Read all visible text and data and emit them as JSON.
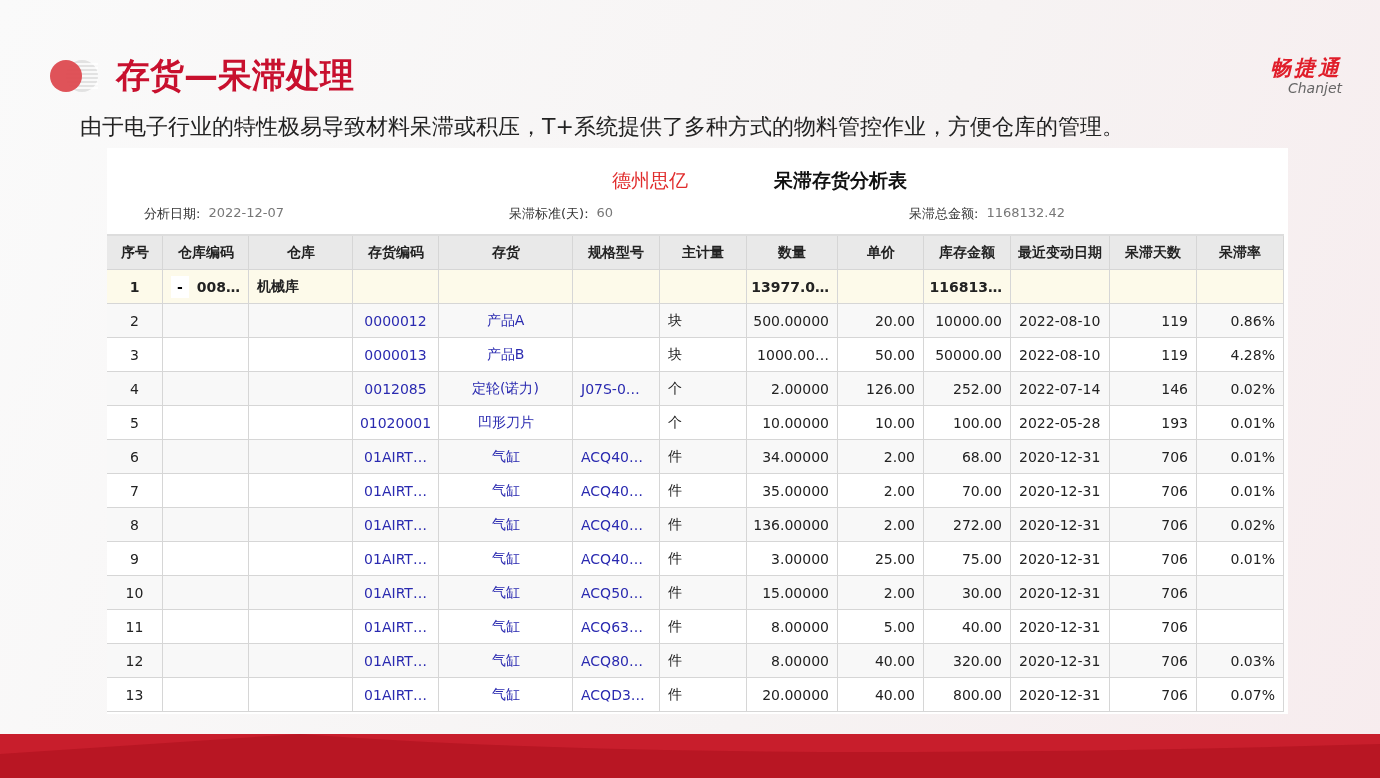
{
  "slide": {
    "title": "存货—呆滞处理",
    "subtitle": "由于电子行业的特性极易导致材料呆滞或积压，T+系统提供了多种方式的物料管控作业，方便仓库的管理。",
    "brand": {
      "name": "畅捷通",
      "latin": "Chanjet"
    }
  },
  "report": {
    "company": "德州思亿",
    "title": "呆滞存货分析表",
    "meta": [
      {
        "label": "分析日期:",
        "value": "2022-12-07"
      },
      {
        "label": "呆滞标准(天):",
        "value": "60"
      },
      {
        "label": "呆滞总金额:",
        "value": "1168132.42"
      }
    ],
    "columns": [
      "序号",
      "仓库编码",
      "仓库",
      "存货编码",
      "存货",
      "规格型号",
      "主计量",
      "数量",
      "单价",
      "库存金额",
      "最近变动日期",
      "呆滞天数",
      "呆滞率"
    ],
    "rows": [
      {
        "kind": "group",
        "toggle": "-",
        "cells": [
          "1",
          "008…",
          "机械库",
          null,
          null,
          null,
          null,
          "13977.0…",
          null,
          "116813…",
          null,
          null,
          null
        ]
      },
      {
        "kind": "item",
        "cells": [
          "2",
          null,
          null,
          "0000012",
          "产品A",
          null,
          "块",
          "500.00000",
          "20.00",
          "10000.00",
          "2022-08-10",
          "119",
          "0.86%"
        ]
      },
      {
        "kind": "item",
        "cells": [
          "3",
          null,
          null,
          "0000013",
          "产品B",
          null,
          "块",
          "1000.00…",
          "50.00",
          "50000.00",
          "2022-08-10",
          "119",
          "4.28%"
        ]
      },
      {
        "kind": "item",
        "cells": [
          "4",
          null,
          null,
          "0012085",
          "定轮(诺力)",
          "J07S-0…",
          "个",
          "2.00000",
          "126.00",
          "252.00",
          "2022-07-14",
          "146",
          "0.02%"
        ]
      },
      {
        "kind": "item",
        "cells": [
          "5",
          null,
          null,
          "01020001",
          "凹形刀片",
          null,
          "个",
          "10.00000",
          "10.00",
          "100.00",
          "2022-05-28",
          "193",
          "0.01%"
        ]
      },
      {
        "kind": "item",
        "cells": [
          "6",
          null,
          null,
          "01AIRT…",
          "气缸",
          "ACQ40…",
          "件",
          "34.00000",
          "2.00",
          "68.00",
          "2020-12-31",
          "706",
          "0.01%"
        ]
      },
      {
        "kind": "item",
        "cells": [
          "7",
          null,
          null,
          "01AIRT…",
          "气缸",
          "ACQ40…",
          "件",
          "35.00000",
          "2.00",
          "70.00",
          "2020-12-31",
          "706",
          "0.01%"
        ]
      },
      {
        "kind": "item",
        "cells": [
          "8",
          null,
          null,
          "01AIRT…",
          "气缸",
          "ACQ40…",
          "件",
          "136.00000",
          "2.00",
          "272.00",
          "2020-12-31",
          "706",
          "0.02%"
        ]
      },
      {
        "kind": "item",
        "cells": [
          "9",
          null,
          null,
          "01AIRT…",
          "气缸",
          "ACQ40…",
          "件",
          "3.00000",
          "25.00",
          "75.00",
          "2020-12-31",
          "706",
          "0.01%"
        ]
      },
      {
        "kind": "item",
        "cells": [
          "10",
          null,
          null,
          "01AIRT…",
          "气缸",
          "ACQ50…",
          "件",
          "15.00000",
          "2.00",
          "30.00",
          "2020-12-31",
          "706",
          null
        ]
      },
      {
        "kind": "item",
        "cells": [
          "11",
          null,
          null,
          "01AIRT…",
          "气缸",
          "ACQ63…",
          "件",
          "8.00000",
          "5.00",
          "40.00",
          "2020-12-31",
          "706",
          null
        ]
      },
      {
        "kind": "item",
        "cells": [
          "12",
          null,
          null,
          "01AIRT…",
          "气缸",
          "ACQ80…",
          "件",
          "8.00000",
          "40.00",
          "320.00",
          "2020-12-31",
          "706",
          "0.03%"
        ]
      },
      {
        "kind": "item",
        "cells": [
          "13",
          null,
          null,
          "01AIRT…",
          "气缸",
          "ACQD3…",
          "件",
          "20.00000",
          "40.00",
          "800.00",
          "2020-12-31",
          "706",
          "0.07%"
        ]
      }
    ]
  }
}
